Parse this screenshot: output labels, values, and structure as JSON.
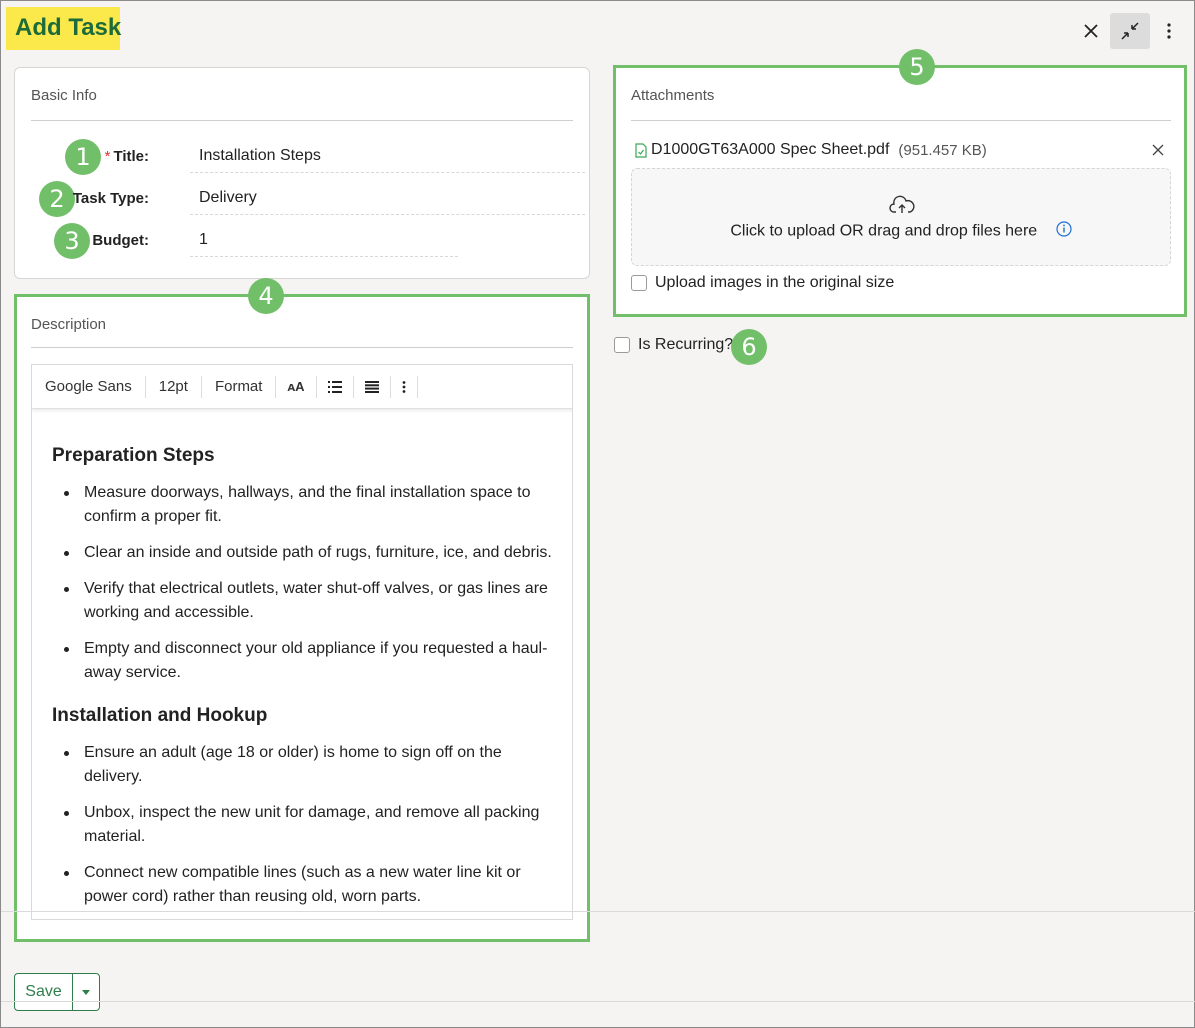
{
  "header": {
    "title": "Add Task",
    "close_icon": "close-icon",
    "minimize_icon": "minimize-icon",
    "more_icon": "more-vertical-icon"
  },
  "basic_info": {
    "title": "Basic Info",
    "fields": [
      {
        "badge": "1",
        "label": "Title:",
        "required": true,
        "value": "Installation Steps"
      },
      {
        "badge": "2",
        "label": "Task Type:",
        "required": false,
        "value": "Delivery"
      },
      {
        "badge": "3",
        "label": "Budget:",
        "required": false,
        "value": "1"
      }
    ]
  },
  "description": {
    "badge": "4",
    "title": "Description",
    "toolbar": {
      "font": "Google Sans",
      "size": "12pt",
      "format": "Format"
    },
    "sections": [
      {
        "heading": "Preparation Steps",
        "items": [
          "Measure doorways, hallways, and the final installation space to confirm a proper fit.",
          "Clear an inside and outside path of rugs, furniture, ice, and debris.",
          "Verify that electrical outlets, water shut-off valves, or gas lines are working and accessible.",
          "Empty and disconnect your old appliance if you requested a haul-away service."
        ]
      },
      {
        "heading": "Installation and Hookup",
        "items": [
          "Ensure an adult (age 18 or older) is home to sign off on the delivery.",
          "Unbox, inspect the new unit for damage, and remove all packing material.",
          "Connect new compatible lines (such as a new water line kit or power cord) rather than reusing old, worn parts."
        ]
      }
    ]
  },
  "attachments": {
    "badge": "5",
    "title": "Attachments",
    "file": {
      "name": "D1000GT63A000 Spec Sheet.pdf",
      "size": "(951.457 KB)"
    },
    "upload_text": "Click to upload OR drag and drop files here",
    "original_size_label": "Upload images in the original size"
  },
  "recurring": {
    "badge": "6",
    "label": "Is Recurring?"
  },
  "footer": {
    "save_label": "Save"
  },
  "colors": {
    "accent_green": "#72bf6a",
    "title_highlight": "#fbe94b",
    "title_text": "#1d6b3b",
    "save_green": "#2e7d4a"
  }
}
